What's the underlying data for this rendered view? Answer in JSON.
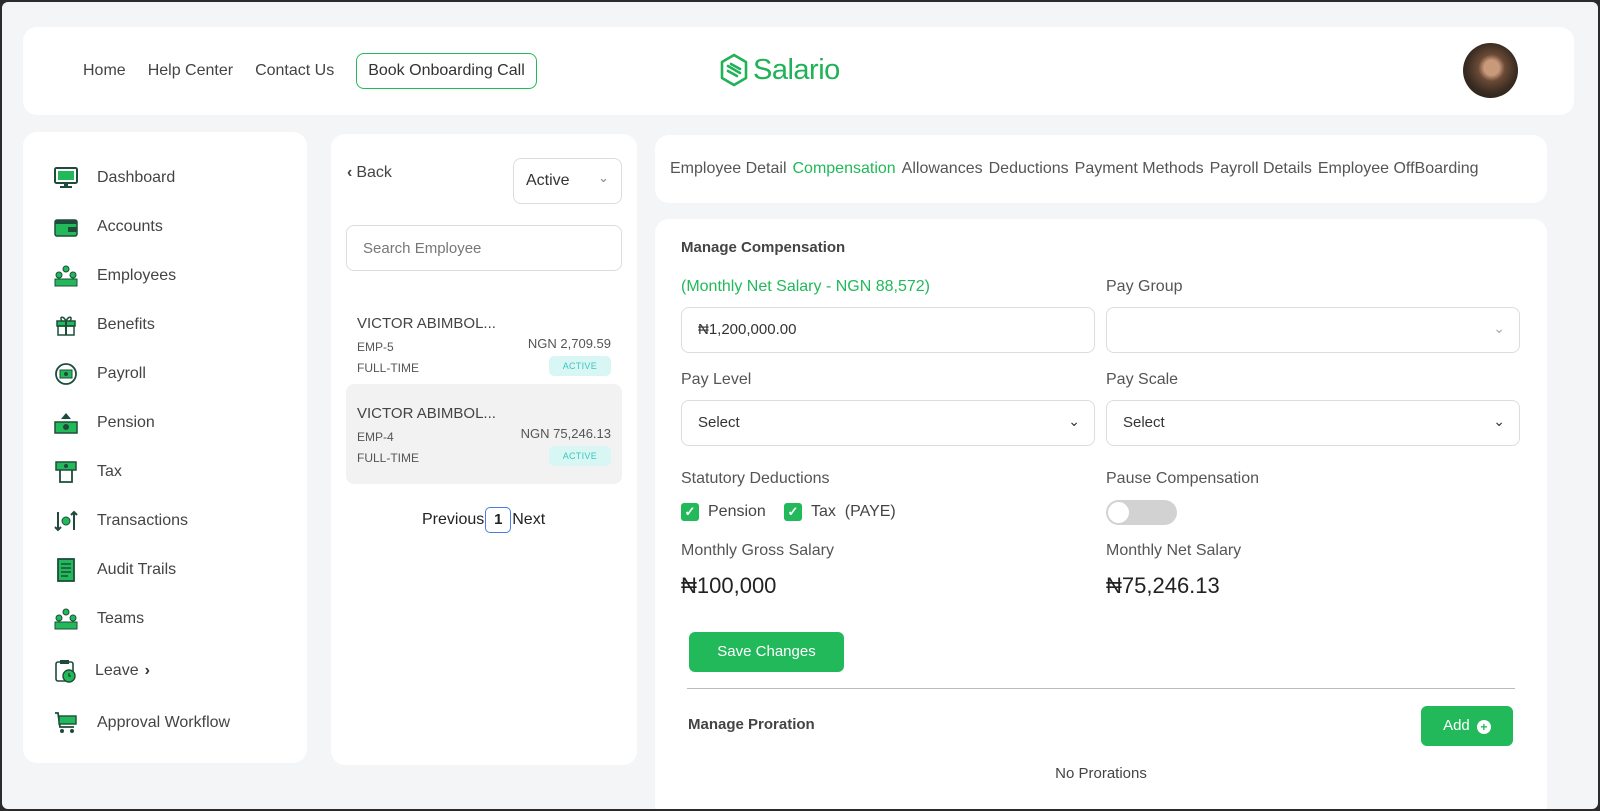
{
  "header": {
    "nav": [
      "Home",
      "Help Center",
      "Contact Us"
    ],
    "cta": "Book Onboarding Call",
    "logo_text": "Salario",
    "brand_color": "#22b95a"
  },
  "sidebar": {
    "items": [
      {
        "label": "Dashboard",
        "icon": "monitor-icon"
      },
      {
        "label": "Accounts",
        "icon": "wallet-icon"
      },
      {
        "label": "Employees",
        "icon": "people-icon"
      },
      {
        "label": "Benefits",
        "icon": "gift-icon"
      },
      {
        "label": "Payroll",
        "icon": "cash-cycle-icon"
      },
      {
        "label": "Pension",
        "icon": "pension-icon"
      },
      {
        "label": "Tax",
        "icon": "tax-icon"
      },
      {
        "label": "Transactions",
        "icon": "transactions-icon"
      },
      {
        "label": "Audit Trails",
        "icon": "document-icon"
      },
      {
        "label": "Teams",
        "icon": "team-icon"
      },
      {
        "label": "Leave",
        "icon": "calendar-clock-icon"
      },
      {
        "label": "Approval Workflow",
        "icon": "cart-icon"
      }
    ]
  },
  "list": {
    "back_label": "Back",
    "status_value": "Active",
    "search_placeholder": "Search Employee",
    "employees": [
      {
        "name": "VICTOR ABIMBOL...",
        "code": "EMP-5",
        "type": "FULL-TIME",
        "amount": "NGN 2,709.59",
        "status": "ACTIVE"
      },
      {
        "name": "VICTOR ABIMBOL...",
        "code": "EMP-4",
        "type": "FULL-TIME",
        "amount": "NGN 75,246.13",
        "status": "ACTIVE"
      }
    ],
    "pager": {
      "prev": "Previous",
      "page": "1",
      "next": "Next"
    }
  },
  "tabs": [
    "Employee Detail",
    "Compensation",
    "Allowances",
    "Deductions",
    "Payment Methods",
    "Payroll Details",
    "Employee OffBoarding"
  ],
  "form": {
    "title": "Manage Compensation",
    "net_label": "(Monthly Net Salary - NGN 88,572)",
    "salary_value": "₦1,200,000.00",
    "pay_group_label": "Pay Group",
    "pay_group_value": "",
    "pay_level_label": "Pay Level",
    "pay_level_value": "Select",
    "pay_scale_label": "Pay Scale",
    "pay_scale_value": "Select",
    "statutory_label": "Statutory Deductions",
    "pension_label": "Pension",
    "tax_label": "Tax  (PAYE)",
    "pause_label": "Pause Compensation",
    "pause_on": false,
    "gross_label": "Monthly Gross Salary",
    "gross_value": "₦100,000",
    "net_salary_label": "Monthly Net Salary",
    "net_salary_value": "₦75,246.13",
    "save_label": "Save Changes",
    "proration_title": "Manage Proration",
    "add_label": "Add",
    "no_prorations": "No Prorations"
  }
}
